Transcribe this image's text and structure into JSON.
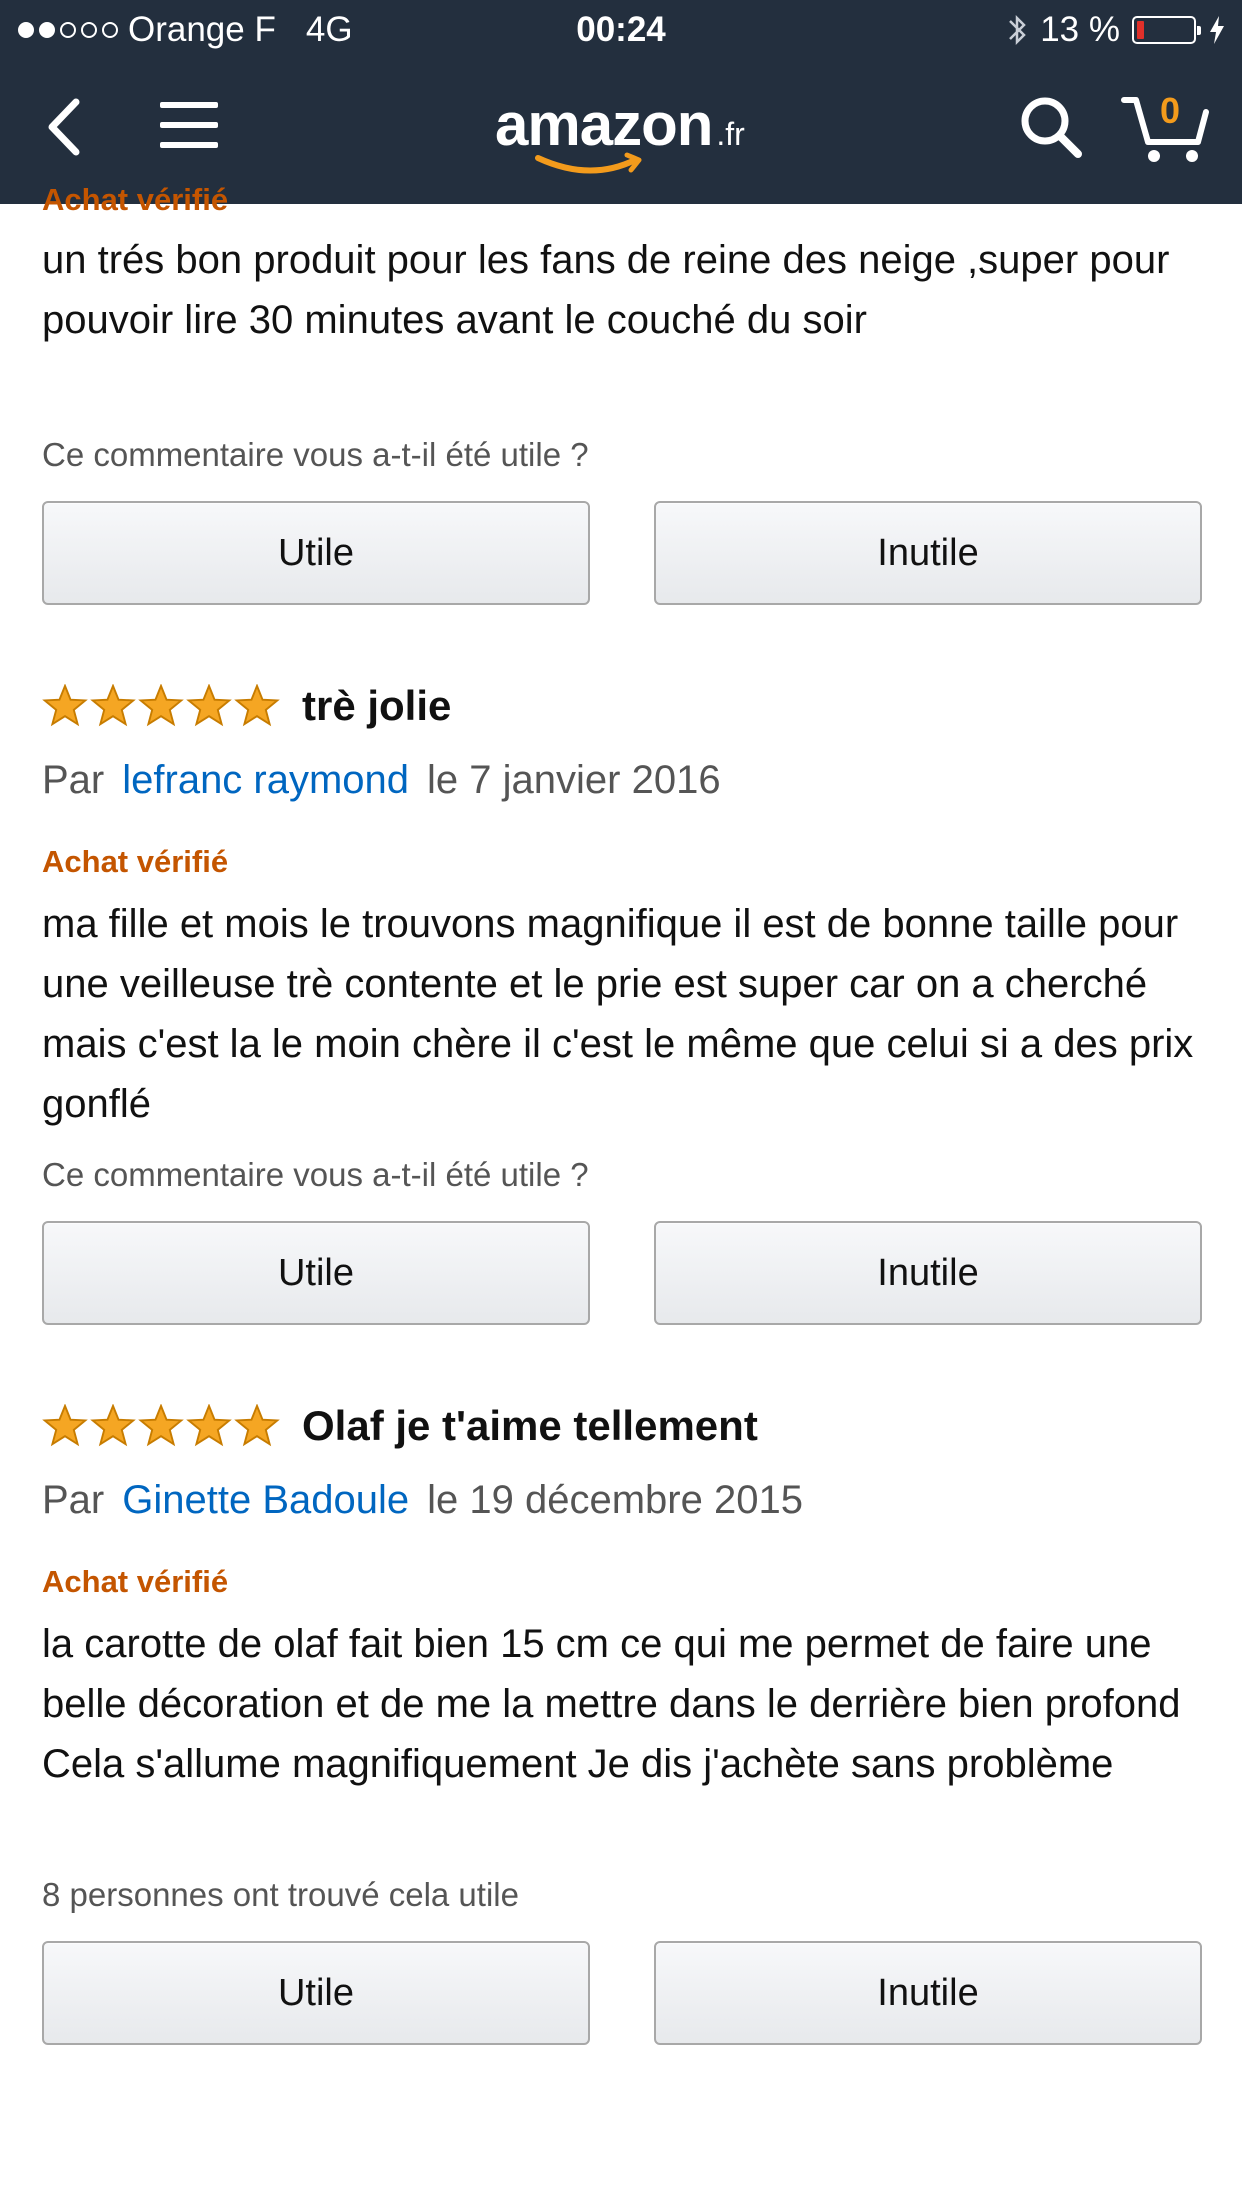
{
  "status_bar": {
    "carrier": "Orange F",
    "network": "4G",
    "time": "00:24",
    "battery": "13 %",
    "battery_level_percent": 13
  },
  "nav": {
    "logo_text": "amazon",
    "logo_tld": ".fr",
    "cart_count": "0",
    "icons": [
      "back-chevron-icon",
      "hamburger-menu-icon",
      "search-icon",
      "cart-icon"
    ]
  },
  "partial_review": {
    "verified": "Achat vérifié",
    "text": "un trés bon produit pour les fans de reine des neige ,super pour pouvoir lire 30 minutes avant le couché du soir",
    "helpful_prompt": "Ce commentaire vous a-t-il été utile ?",
    "btn_yes": "Utile",
    "btn_no": "Inutile"
  },
  "reviews": [
    {
      "stars": 5,
      "title": "trè jolie",
      "by": "Par",
      "author": "lefranc raymond",
      "date": "le 7 janvier 2016",
      "verified": "Achat vérifié",
      "text": "ma fille et mois le trouvons magnifique il est de bonne taille pour une veilleuse trè contente et le prie est super car on a cherché mais c'est la le moin chère il c'est le même que celui si a des prix gonflé",
      "helpful_prompt": "Ce commentaire vous a-t-il été utile ?",
      "btn_yes": "Utile",
      "btn_no": "Inutile"
    },
    {
      "stars": 5,
      "title": "Olaf je t'aime tellement",
      "by": "Par",
      "author": "Ginette Badoule",
      "date": "le 19 décembre 2015",
      "verified": "Achat vérifié",
      "text": "la carotte de olaf fait bien 15 cm ce qui me permet de faire une belle décoration et de me la mettre dans le derrière bien profond Cela s'allume magnifiquement Je dis j'achète sans problème",
      "helpful_prompt": "8 personnes ont trouvé cela utile",
      "btn_yes": "Utile",
      "btn_no": "Inutile"
    }
  ],
  "colors": {
    "header_bg": "#232f3e",
    "verified": "#c45500",
    "author_link": "#0066c0",
    "star": "#f5a623",
    "logo_smile": "#f39b1c"
  }
}
